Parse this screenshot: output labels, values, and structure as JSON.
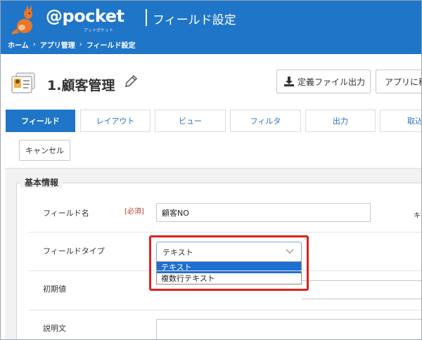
{
  "header": {
    "brand": "@pocket",
    "brand_sub": "アットポケット",
    "page_heading": "フィールド設定",
    "breadcrumb": [
      "ホーム",
      "アプリ管理",
      "フィールド設定"
    ],
    "breadcrumb_sep": "›"
  },
  "title": {
    "app_name": "1.顧客管理",
    "export_label": "定義ファイル出力",
    "move_label": "アプリに移"
  },
  "tabs": [
    {
      "label": "フィールド",
      "active": true
    },
    {
      "label": "レイアウト",
      "active": false
    },
    {
      "label": "ビュー",
      "active": false
    },
    {
      "label": "フィルタ",
      "active": false
    },
    {
      "label": "出力",
      "active": false
    },
    {
      "label": "取込",
      "active": false
    }
  ],
  "cancel_label": "キャンセル",
  "form": {
    "section_title": "基本情報",
    "field_name_label": "フィールド名",
    "required_badge": "[必須]",
    "field_name_value": "顧客NO",
    "right_hint": "キ",
    "field_type_label": "フィールドタイプ",
    "field_type_value": "テキスト",
    "field_type_options": [
      "テキスト",
      "複数行テキスト"
    ],
    "initial_value_label": "初期値",
    "description_label": "説明文"
  },
  "colors": {
    "header_blue": "#1f76c9",
    "highlight_red": "#e02020",
    "selected_option": "#1e6fd1",
    "required_red": "#c0392b"
  }
}
